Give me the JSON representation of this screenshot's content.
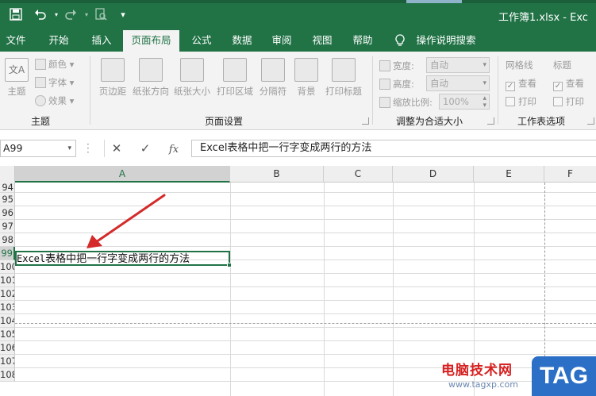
{
  "colors": {
    "accent": "#217346",
    "ribbon_bg": "#f3f3f3",
    "arrow": "#d42a2a",
    "watermark_red": "#d62020",
    "watermark_blue": "#2b6fc6"
  },
  "titlebar": {
    "title": "工作簿1.xlsx  -  Exc",
    "icons": [
      "save-icon",
      "undo-icon",
      "redo-icon",
      "print-preview-icon",
      "customize-qat-icon"
    ]
  },
  "tabs": [
    {
      "label": "文件"
    },
    {
      "label": "开始"
    },
    {
      "label": "插入"
    },
    {
      "label": "页面布局",
      "active": true
    },
    {
      "label": "公式"
    },
    {
      "label": "数据"
    },
    {
      "label": "审阅"
    },
    {
      "label": "视图"
    },
    {
      "label": "帮助"
    }
  ],
  "tell_me": "操作说明搜索",
  "ribbon": {
    "themes": {
      "label": "主题",
      "theme_button": "主题",
      "colors": "颜色",
      "fonts": "字体",
      "effects": "效果",
      "theme_icon_text": "文A"
    },
    "page_setup": {
      "label": "页面设置",
      "buttons": [
        "页边距",
        "纸张方向",
        "纸张大小",
        "打印区域",
        "分隔符",
        "背景",
        "打印标题"
      ]
    },
    "scale_to_fit": {
      "label": "调整为合适大小",
      "width_label": "宽度:",
      "width_value": "自动",
      "height_label": "高度:",
      "height_value": "自动",
      "scale_label": "缩放比例:",
      "scale_value": "100%"
    },
    "sheet_options": {
      "label": "工作表选项",
      "gridlines": "网格线",
      "headings": "标题",
      "view": "查看",
      "print": "打印"
    }
  },
  "formula_bar": {
    "name_box": "A99",
    "cancel": "✕",
    "enter": "✓",
    "fx": "fx",
    "content": "Excel表格中把一行字变成两行的方法"
  },
  "grid": {
    "columns": [
      "A",
      "B",
      "C",
      "D",
      "E",
      "F"
    ],
    "rows": [
      "94",
      "95",
      "96",
      "97",
      "98",
      "99",
      "100",
      "101",
      "102",
      "103",
      "104",
      "105",
      "106",
      "107",
      "108"
    ],
    "active_cell": "A99",
    "cell_value_latin": "Excel",
    "cell_value_cjk": "表格中把一行字变成两行的方法"
  },
  "watermark": {
    "text": "电脑技术网",
    "url": "www.tagxp.com",
    "logo": "TAG"
  }
}
